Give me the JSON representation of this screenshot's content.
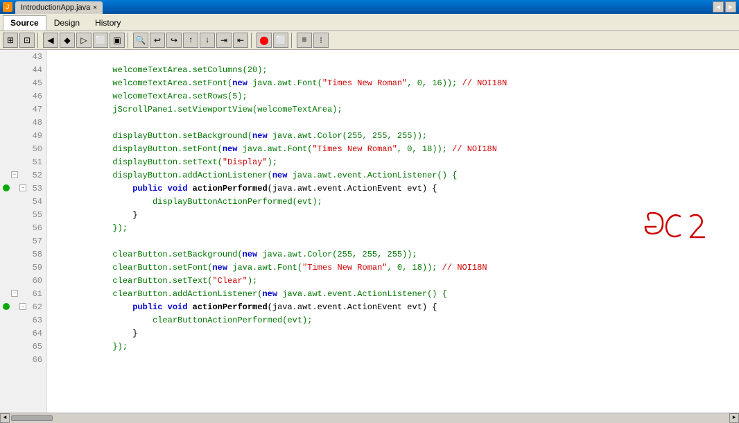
{
  "titlebar": {
    "tab_name": "IntroductionApp.java",
    "close_label": "×",
    "nav_left": "◄",
    "nav_right": "►"
  },
  "tabs": [
    {
      "label": "Source",
      "active": true
    },
    {
      "label": "Design",
      "active": false
    },
    {
      "label": "History",
      "active": false
    }
  ],
  "toolbar": {
    "buttons": [
      "⊡",
      "⊞",
      "◄",
      "►",
      "⊟",
      "🔍",
      "←",
      "→",
      "↑",
      "↓",
      "⊕",
      "⊗",
      "⊘",
      "✦",
      "◉",
      "○",
      "▣",
      "□",
      "◈",
      "⬛",
      "⬡",
      "◼",
      "⬤",
      "⚫"
    ]
  },
  "lines": [
    {
      "num": "43",
      "code": "",
      "indent": 0
    },
    {
      "num": "44",
      "code": "            welcomeTextArea.setColumns(20);",
      "color": "green"
    },
    {
      "num": "45",
      "code": "            welcomeTextArea.setFont(new java.awt.Font(\"Times New Roman\", 0, 16)); // NOI18N",
      "has_string": true
    },
    {
      "num": "46",
      "code": "            welcomeTextArea.setRows(5);",
      "color": "green"
    },
    {
      "num": "47",
      "code": "            jScrollPane1.setViewportView(welcomeTextArea);",
      "color": "green"
    },
    {
      "num": "48",
      "code": "",
      "indent": 0
    },
    {
      "num": "49",
      "code": "            displayButton.setBackground(new java.awt.Color(255, 255, 255));",
      "color": "green"
    },
    {
      "num": "50",
      "code": "            displayButton.setFont(new java.awt.Font(\"Times New Roman\", 0, 18)); // NOI18N",
      "has_string": true
    },
    {
      "num": "51",
      "code": "            displayButton.setText(\"Display\");",
      "has_string": true
    },
    {
      "num": "52",
      "code": "            displayButton.addActionListener(new java.awt.event.ActionListener() {",
      "color": "green",
      "foldable": true
    },
    {
      "num": "53",
      "code": "                public void actionPerformed(java.awt.event.ActionEvent evt) {",
      "has_bp": true,
      "foldable2": true
    },
    {
      "num": "54",
      "code": "                    displayButtonActionPerformed(evt);",
      "color": "green"
    },
    {
      "num": "55",
      "code": "                }",
      "color": "plain"
    },
    {
      "num": "56",
      "code": "            });",
      "color": "green"
    },
    {
      "num": "57",
      "code": "",
      "indent": 0
    },
    {
      "num": "58",
      "code": "            clearButton.setBackground(new java.awt.Color(255, 255, 255));",
      "color": "green"
    },
    {
      "num": "59",
      "code": "            clearButton.setFont(new java.awt.Font(\"Times New Roman\", 0, 18)); // NOI18N",
      "has_string": true
    },
    {
      "num": "60",
      "code": "            clearButton.setText(\"Clear\");",
      "has_string": true
    },
    {
      "num": "61",
      "code": "            clearButton.addActionListener(new java.awt.event.ActionListener() {",
      "color": "green",
      "foldable": true
    },
    {
      "num": "62",
      "code": "                public void actionPerformed(java.awt.event.ActionEvent evt) {",
      "has_bp": true,
      "foldable2": true
    },
    {
      "num": "63",
      "code": "                    clearButtonActionPerformed(evt);",
      "color": "green"
    },
    {
      "num": "64",
      "code": "                }",
      "color": "plain"
    },
    {
      "num": "65",
      "code": "            });",
      "color": "green"
    },
    {
      "num": "66",
      "code": "",
      "indent": 0
    }
  ],
  "annotation": "GC 2",
  "scrollbar": {
    "left_arrow": "◄",
    "right_arrow": "►"
  }
}
